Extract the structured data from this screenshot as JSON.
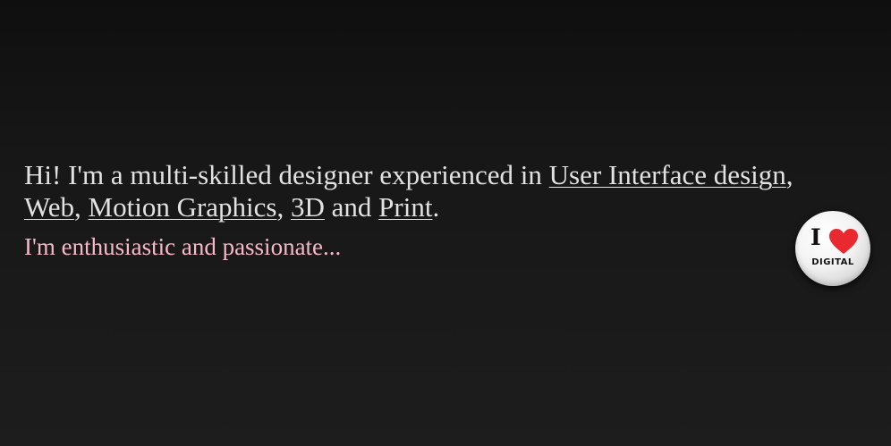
{
  "intro": {
    "greeting": "Hi! I'm a multi-skilled designer experienced in ",
    "links": [
      "User Interface design",
      "Web",
      "Motion Graphics",
      "3D",
      "Print"
    ],
    "sep_1": ", ",
    "sep_2": ", ",
    "sep_3": ", ",
    "conj": " and ",
    "end": "."
  },
  "tagline": "I'm enthusiastic and passionate...",
  "badge": {
    "letter": "I",
    "word": "DIGITAL",
    "heart_color": "#e8292f"
  },
  "colors": {
    "text": "#e2e2e2",
    "tagline": "#f7b9c9",
    "background": "#161616"
  }
}
